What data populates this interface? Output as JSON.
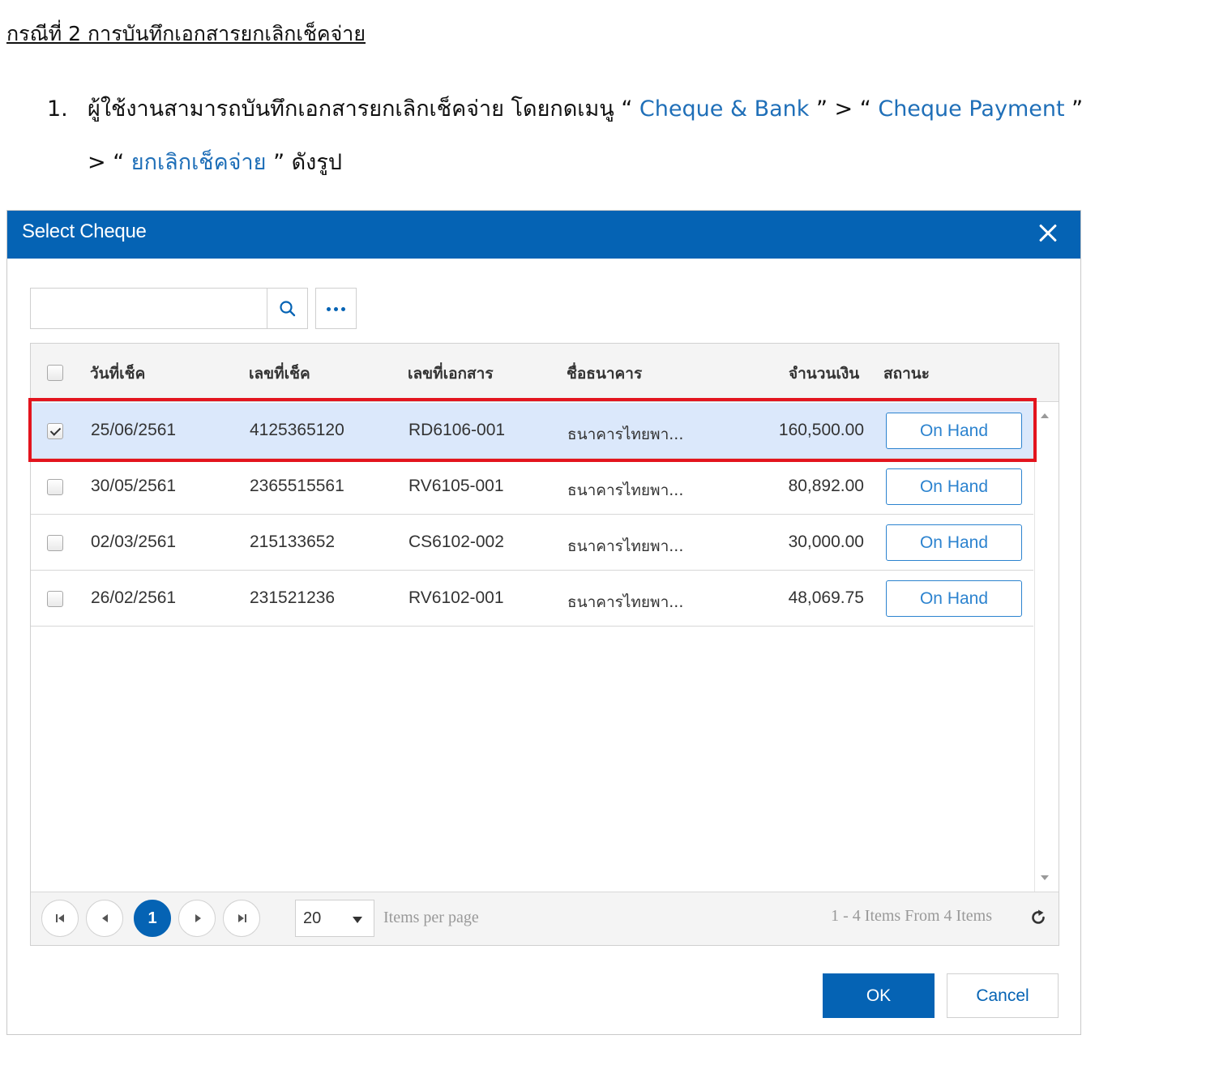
{
  "document": {
    "heading": "กรณีที่ 2 การบันทึกเอกสารยกเลิกเช็คจ่าย",
    "step1": {
      "number": "1.",
      "text_a": "ผู้ใช้งานสามารถบันทึกเอกสารยกเลิกเช็คจ่าย โดยกดเมนู “ ",
      "link_a": "Cheque & Bank",
      "text_b": " ” > “ ",
      "link_b": "Cheque Payment",
      "text_c": " ”",
      "text_d": "> “ ",
      "link_c": "ยกเลิกเช็คจ่าย",
      "text_e": " ”  ดังรูป"
    }
  },
  "dialog": {
    "title": "Select Cheque",
    "search_value": "",
    "columns": {
      "date": "วันที่เช็ค",
      "cheque_no": "เลขที่เช็ค",
      "doc_no": "เลขที่เอกสาร",
      "bank": "ชื่อธนาคาร",
      "amount": "จำนวนเงิน",
      "status": "สถานะ"
    },
    "rows": [
      {
        "date": "25/06/2561",
        "cheque_no": "4125365120",
        "doc_no": "RD6106-001",
        "bank": "ธนาคารไทยพา...",
        "amount": "160,500.00",
        "status": "On Hand"
      },
      {
        "date": "30/05/2561",
        "cheque_no": "2365515561",
        "doc_no": "RV6105-001",
        "bank": "ธนาคารไทยพา...",
        "amount": "80,892.00",
        "status": "On Hand"
      },
      {
        "date": "02/03/2561",
        "cheque_no": "215133652",
        "doc_no": "CS6102-002",
        "bank": "ธนาคารไทยพา...",
        "amount": "30,000.00",
        "status": "On Hand"
      },
      {
        "date": "26/02/2561",
        "cheque_no": "231521236",
        "doc_no": "RV6102-001",
        "bank": "ธนาคารไทยพา...",
        "amount": "48,069.75",
        "status": "On Hand"
      }
    ],
    "selected_row_index": 0,
    "pager": {
      "current_page": "1",
      "page_size": "20",
      "per_page_label": "Items per page",
      "items_info": "1 - 4 Items From 4 Items"
    },
    "ok_label": "OK",
    "cancel_label": "Cancel"
  },
  "colors": {
    "header_blue": "#0563b4",
    "link_blue": "#1f6fb8",
    "selected_row": "#dbe8fb",
    "highlight_red": "#e3141e"
  },
  "icons": [
    "close-icon",
    "search-icon",
    "more-icon",
    "first-page-icon",
    "prev-page-icon",
    "next-page-icon",
    "last-page-icon",
    "dropdown-arrow-icon",
    "refresh-icon",
    "checkbox-check-icon"
  ]
}
